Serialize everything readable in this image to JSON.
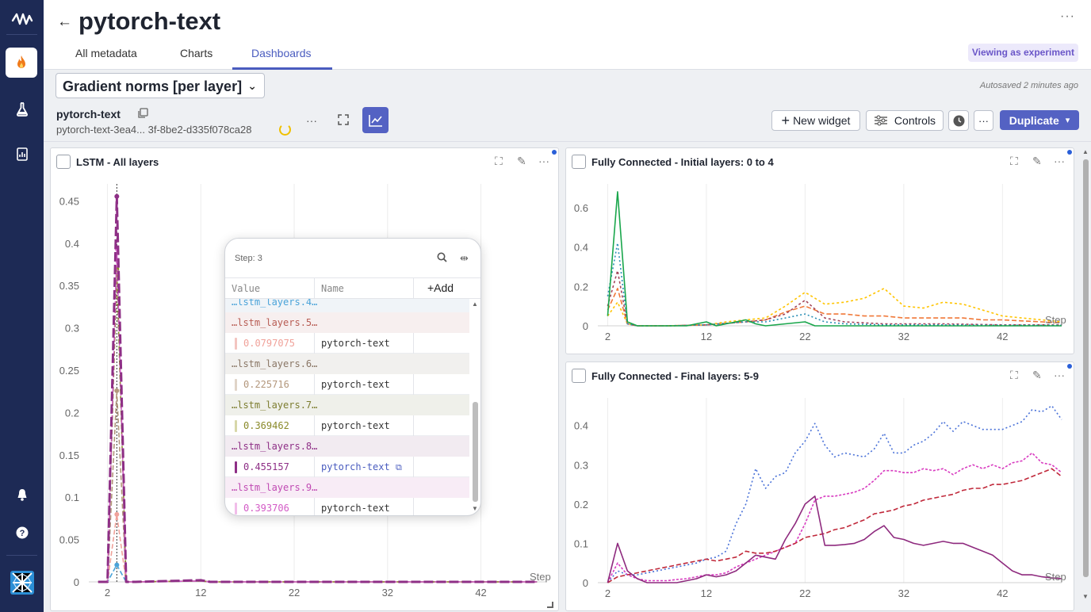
{
  "app": {
    "title": "pytorch-text",
    "more_label": "···"
  },
  "tabs": [
    {
      "label": "All metadata"
    },
    {
      "label": "Charts"
    },
    {
      "label": "Dashboards"
    }
  ],
  "viewing_badge": "Viewing as experiment",
  "toolbar": {
    "dashboard_name": "Gradient norms [per layer]",
    "autosave": "Autosaved 2 minutes ago",
    "experiment_name": "pytorch-text",
    "experiment_id": "pytorch-text-3ea4... 3f-8be2-d335f078ca28",
    "new_widget_label": "New widget",
    "controls_label": "Controls",
    "duplicate_label": "Duplicate"
  },
  "widgets": {
    "lstm": {
      "title": "LSTM - All layers",
      "step_label": "Step"
    },
    "fc_initial": {
      "title": "Fully Connected - Initial layers: 0 to 4",
      "step_label": "Step"
    },
    "fc_final": {
      "title": "Fully Connected - Final layers: 5-9",
      "step_label": "Step"
    }
  },
  "tooltip": {
    "step": "Step: 3",
    "col_value": "Value",
    "col_name": "Name",
    "add_label": "+Add",
    "groups": [
      {
        "label": "…lstm_layers.4…",
        "color": "#4aa3d9"
      },
      {
        "label": "…lstm_layers.5…",
        "color": "#e07a70"
      },
      {
        "label": "…lstm_layers.6…",
        "color": "#9c8470"
      },
      {
        "label": "…lstm_layers.7…",
        "color": "#8a8a2a"
      },
      {
        "label": "…lstm_layers.8…",
        "color": "#8e2f86"
      },
      {
        "label": "…lstm_layers.9…",
        "color": "#d35bc6"
      }
    ],
    "rows": [
      {
        "value": "0.0797075",
        "name": "pytorch-text",
        "color": "#f0a29a"
      },
      {
        "value": "0.225716",
        "name": "pytorch-text",
        "color": "#b3977c"
      },
      {
        "value": "0.369462",
        "name": "pytorch-text",
        "color": "#8a8a2a"
      },
      {
        "value": "0.455157",
        "name": "pytorch-text",
        "color": "#8e2f86"
      },
      {
        "value": "0.393706",
        "name": "pytorch-text",
        "color": "#d35bc6"
      }
    ]
  },
  "chart_data": [
    {
      "type": "line",
      "title": "LSTM - All layers",
      "xlabel": "Step",
      "xlim": [
        0,
        49
      ],
      "ylim": [
        0,
        0.47
      ],
      "xticks": [
        2,
        12,
        22,
        32,
        42
      ],
      "yticks": [
        0,
        0.05,
        0.1,
        0.15,
        0.2,
        0.25,
        0.3,
        0.35,
        0.4,
        0.45
      ],
      "series": [
        {
          "color": "#4aa3d9",
          "dash": "6,3",
          "x": [
            1,
            2,
            3,
            4,
            5,
            12,
            13,
            20,
            30,
            40,
            48
          ],
          "y": [
            0,
            0,
            0.02,
            0,
            0,
            0.001,
            0,
            0,
            0,
            0,
            0
          ]
        },
        {
          "color": "#f0a29a",
          "dash": "6,3",
          "x": [
            1,
            2,
            3,
            4,
            5,
            12,
            13,
            20,
            30,
            40,
            48
          ],
          "y": [
            0,
            0,
            0.0797,
            0,
            0,
            0.001,
            0,
            0,
            0,
            0,
            0
          ]
        },
        {
          "color": "#b3977c",
          "dash": "6,3",
          "x": [
            1,
            2,
            3,
            4,
            5,
            12,
            13,
            20,
            30,
            40,
            48
          ],
          "y": [
            0,
            0,
            0.2257,
            0,
            0,
            0.001,
            0,
            0,
            0,
            0,
            0
          ]
        },
        {
          "color": "#8a8a2a",
          "dash": "6,3",
          "x": [
            1,
            2,
            3,
            4,
            5,
            12,
            13,
            20,
            30,
            40,
            48
          ],
          "y": [
            0,
            0,
            0.3695,
            0,
            0,
            0.001,
            0,
            0,
            0,
            0,
            0
          ]
        },
        {
          "color": "#d35bc6",
          "dash": "6,3",
          "x": [
            1,
            2,
            3,
            4,
            5,
            12,
            13,
            20,
            30,
            40,
            48
          ],
          "y": [
            0,
            0,
            0.3937,
            0,
            0,
            0.001,
            0,
            0,
            0,
            0,
            0
          ]
        },
        {
          "color": "#8e2f86",
          "dash": "12,4",
          "x": [
            1,
            2,
            3,
            4,
            5,
            12,
            13,
            20,
            30,
            40,
            48
          ],
          "y": [
            0,
            0,
            0.4552,
            0,
            0,
            0.002,
            0,
            0,
            0,
            0,
            0
          ]
        }
      ]
    },
    {
      "type": "line",
      "title": "Fully Connected - Initial layers: 0 to 4",
      "xlabel": "Step",
      "xlim": [
        1,
        48
      ],
      "ylim": [
        0,
        0.72
      ],
      "xticks": [
        2,
        12,
        22,
        32,
        42
      ],
      "yticks": [
        0,
        0.2,
        0.4,
        0.6
      ],
      "series": [
        {
          "color": "#ffc400",
          "dash": "3,3",
          "x": [
            2,
            3,
            4,
            5,
            8,
            12,
            14,
            16,
            18,
            20,
            22,
            24,
            26,
            28,
            30,
            32,
            34,
            36,
            38,
            40,
            42,
            44,
            46,
            48
          ],
          "y": [
            0.05,
            0.12,
            0.01,
            0,
            0,
            0.005,
            0.02,
            0.03,
            0.04,
            0.1,
            0.17,
            0.11,
            0.12,
            0.14,
            0.19,
            0.1,
            0.09,
            0.12,
            0.11,
            0.08,
            0.05,
            0.04,
            0.03,
            0.02
          ]
        },
        {
          "color": "#f07838",
          "dash": "6,3",
          "x": [
            2,
            3,
            4,
            5,
            8,
            12,
            16,
            18,
            20,
            22,
            24,
            26,
            28,
            30,
            32,
            34,
            36,
            38,
            40,
            42,
            44,
            46,
            48
          ],
          "y": [
            0.08,
            0.19,
            0.01,
            0,
            0,
            0.005,
            0.02,
            0.03,
            0.07,
            0.1,
            0.06,
            0.06,
            0.05,
            0.05,
            0.04,
            0.04,
            0.04,
            0.04,
            0.03,
            0.03,
            0.025,
            0.02,
            0.015
          ]
        },
        {
          "color": "#a3455a",
          "dash": "3,3",
          "x": [
            2,
            3,
            4,
            5,
            8,
            12,
            16,
            18,
            20,
            22,
            24,
            26,
            30,
            36,
            42,
            48
          ],
          "y": [
            0.1,
            0.28,
            0.01,
            0,
            0,
            0.005,
            0.02,
            0.03,
            0.06,
            0.13,
            0.04,
            0.02,
            0.01,
            0.01,
            0.005,
            0.005
          ]
        },
        {
          "color": "#2a8fb5",
          "dash": "2,3",
          "x": [
            2,
            3,
            4,
            5,
            8,
            12,
            16,
            18,
            20,
            22,
            24,
            26,
            30,
            36,
            42,
            48
          ],
          "y": [
            0.15,
            0.42,
            0.01,
            0,
            0,
            0.005,
            0.02,
            0.02,
            0.04,
            0.06,
            0.02,
            0.01,
            0.005,
            0.005,
            0.003,
            0.003
          ]
        },
        {
          "color": "#19a64b",
          "dash": "",
          "x": [
            2,
            3,
            4,
            5,
            6,
            8,
            10,
            12,
            13,
            14,
            16,
            17,
            18,
            20,
            22,
            23,
            24,
            26,
            30,
            36,
            42,
            48
          ],
          "y": [
            0.05,
            0.68,
            0.02,
            0,
            0,
            0,
            0,
            0.02,
            0,
            0.01,
            0.03,
            0.01,
            0,
            0.01,
            0.02,
            0,
            0,
            0,
            0,
            0,
            0,
            0
          ]
        }
      ]
    },
    {
      "type": "line",
      "title": "Fully Connected - Final layers: 5-9",
      "xlabel": "Step",
      "xlim": [
        1,
        48
      ],
      "ylim": [
        0,
        0.47
      ],
      "xticks": [
        2,
        12,
        22,
        32,
        42
      ],
      "yticks": [
        0,
        0.1,
        0.2,
        0.3,
        0.4
      ],
      "series": [
        {
          "color": "#4a72d8",
          "dash": "2,3",
          "x": [
            2,
            3,
            4,
            5,
            6,
            7,
            8,
            9,
            10,
            11,
            12,
            13,
            14,
            15,
            16,
            17,
            18,
            19,
            20,
            21,
            22,
            23,
            24,
            25,
            26,
            27,
            28,
            29,
            30,
            31,
            32,
            33,
            34,
            35,
            36,
            37,
            38,
            39,
            40,
            41,
            42,
            43,
            44,
            45,
            46,
            47,
            48
          ],
          "y": [
            0,
            0.03,
            0.02,
            0.02,
            0.025,
            0.03,
            0.035,
            0.04,
            0.045,
            0.05,
            0.06,
            0.065,
            0.08,
            0.15,
            0.2,
            0.29,
            0.24,
            0.27,
            0.28,
            0.33,
            0.36,
            0.405,
            0.35,
            0.32,
            0.33,
            0.325,
            0.32,
            0.34,
            0.38,
            0.33,
            0.33,
            0.35,
            0.36,
            0.38,
            0.41,
            0.385,
            0.41,
            0.4,
            0.39,
            0.39,
            0.39,
            0.4,
            0.41,
            0.44,
            0.435,
            0.45,
            0.415
          ]
        },
        {
          "color": "#d83bc0",
          "dash": "3,2",
          "x": [
            2,
            3,
            4,
            5,
            6,
            7,
            8,
            9,
            10,
            11,
            12,
            13,
            14,
            15,
            16,
            17,
            18,
            19,
            20,
            21,
            22,
            23,
            24,
            25,
            26,
            27,
            28,
            29,
            30,
            31,
            32,
            33,
            34,
            35,
            36,
            37,
            38,
            39,
            40,
            41,
            42,
            43,
            44,
            45,
            46,
            47,
            48
          ],
          "y": [
            0,
            0.05,
            0.02,
            0.01,
            0.005,
            0.005,
            0.005,
            0.008,
            0.01,
            0.015,
            0.02,
            0.02,
            0.025,
            0.04,
            0.05,
            0.06,
            0.07,
            0.08,
            0.09,
            0.1,
            0.15,
            0.21,
            0.22,
            0.22,
            0.225,
            0.23,
            0.24,
            0.26,
            0.285,
            0.285,
            0.28,
            0.28,
            0.29,
            0.285,
            0.29,
            0.275,
            0.29,
            0.3,
            0.29,
            0.3,
            0.29,
            0.305,
            0.31,
            0.33,
            0.305,
            0.3,
            0.28
          ]
        },
        {
          "color": "#c0283a",
          "dash": "6,3",
          "x": [
            2,
            3,
            4,
            5,
            6,
            7,
            8,
            9,
            10,
            11,
            12,
            13,
            14,
            15,
            16,
            17,
            18,
            19,
            20,
            21,
            22,
            23,
            24,
            25,
            26,
            27,
            28,
            29,
            30,
            31,
            32,
            33,
            34,
            35,
            36,
            37,
            38,
            39,
            40,
            41,
            42,
            43,
            44,
            45,
            46,
            47,
            48
          ],
          "y": [
            0,
            0.015,
            0.02,
            0.025,
            0.03,
            0.035,
            0.04,
            0.045,
            0.05,
            0.055,
            0.06,
            0.055,
            0.06,
            0.065,
            0.08,
            0.075,
            0.075,
            0.08,
            0.09,
            0.1,
            0.115,
            0.12,
            0.125,
            0.135,
            0.14,
            0.15,
            0.16,
            0.175,
            0.18,
            0.185,
            0.195,
            0.2,
            0.21,
            0.215,
            0.22,
            0.225,
            0.235,
            0.24,
            0.24,
            0.25,
            0.25,
            0.255,
            0.26,
            0.27,
            0.28,
            0.29,
            0.27
          ]
        },
        {
          "color": "#8e2a7e",
          "dash": "",
          "x": [
            2,
            3,
            4,
            5,
            6,
            7,
            8,
            9,
            10,
            11,
            12,
            13,
            14,
            15,
            16,
            17,
            18,
            19,
            20,
            21,
            22,
            23,
            24,
            25,
            26,
            27,
            28,
            29,
            30,
            31,
            32,
            33,
            34,
            35,
            36,
            37,
            38,
            39,
            40,
            41,
            42,
            43,
            44,
            45,
            46,
            47,
            48
          ],
          "y": [
            0,
            0.1,
            0.03,
            0.01,
            0,
            0,
            0,
            0,
            0.005,
            0.01,
            0.02,
            0.015,
            0.02,
            0.03,
            0.05,
            0.07,
            0.065,
            0.06,
            0.11,
            0.15,
            0.2,
            0.22,
            0.095,
            0.095,
            0.097,
            0.1,
            0.11,
            0.13,
            0.145,
            0.115,
            0.11,
            0.1,
            0.095,
            0.1,
            0.105,
            0.1,
            0.1,
            0.09,
            0.08,
            0.07,
            0.05,
            0.03,
            0.02,
            0.02,
            0.015,
            0.012,
            0.01
          ]
        }
      ]
    }
  ]
}
